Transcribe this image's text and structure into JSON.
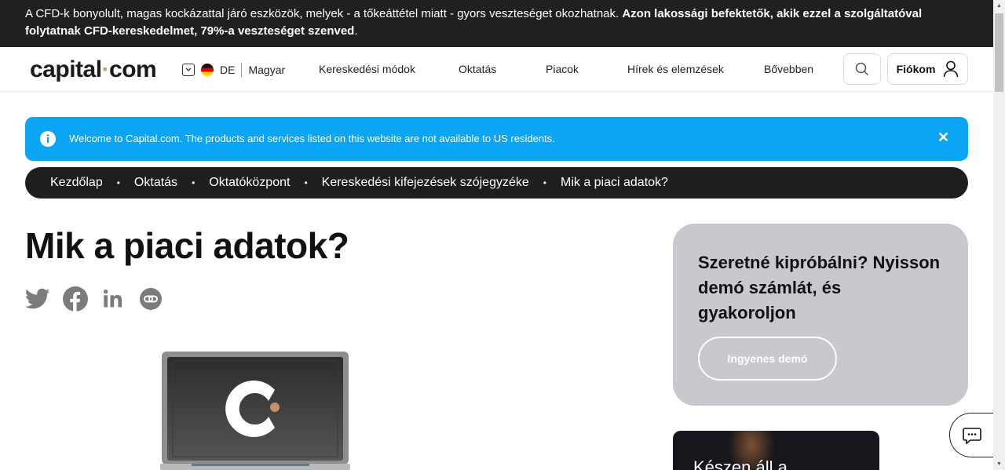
{
  "risk_warning": {
    "text_normal": "A CFD-k bonyolult, magas kockázattal járó eszközök, melyek - a tőkeáttétel miatt - gyors veszteséget okozhatnak. ",
    "text_bold": "Azon lakossági befektetők, akik ezzel a szolgáltatóval folytatnak CFD-kereskedelmet, 79%-a veszteséget szenved",
    "text_end": "."
  },
  "header": {
    "logo_left": "capital",
    "logo_dot": "·",
    "logo_right": "com",
    "country_code": "DE",
    "language": "Magyar",
    "nav": [
      "Kereskedési módok",
      "Oktatás",
      "Piacok",
      "Hírek és elemzések",
      "Bővebben"
    ],
    "account_label": "Fiókom"
  },
  "info_banner": {
    "message": "Welcome to Capital.com. The products and services listed on this website are not available to US residents.",
    "close_symbol": "✕"
  },
  "breadcrumb": [
    "Kezdőlap",
    "Oktatás",
    "Oktatóközpont",
    "Kereskedési kifejezések szójegyzéke",
    "Mik a piaci adatok?"
  ],
  "breadcrumb_separator": "•",
  "page_title": "Mik a piaci adatok?",
  "share_icons": [
    "twitter-icon",
    "facebook-icon",
    "linkedin-icon",
    "copy-link-icon"
  ],
  "demo_card": {
    "heading": "Szeretné kipróbálni? Nyisson demó számlát, és gyakoroljon",
    "button_label": "Ingyenes demó"
  },
  "dark_card": {
    "text": "Készen áll a"
  },
  "colors": {
    "accent_blue": "#0ba5f6",
    "dark": "#1e1e1e",
    "logo_dot": "#d09c72",
    "demo_card_bg": "#c9c8ce"
  }
}
